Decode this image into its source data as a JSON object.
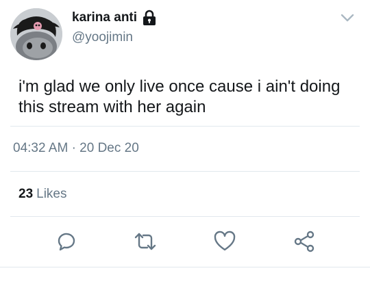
{
  "author": {
    "display_name": "karina anti",
    "handle": "@yoojimin",
    "protected_icon": "lock-icon",
    "avatar_icon": "avatar-kuromi"
  },
  "menu_icon": "chevron-down-icon",
  "tweet": {
    "text": "i'm glad we only live once cause i ain't doing this stream with her again",
    "time": "04:32 AM",
    "separator": "·",
    "date": "20 Dec 20"
  },
  "stats": {
    "likes_count": "23",
    "likes_label": "Likes"
  },
  "actions": [
    {
      "icon": "reply-icon"
    },
    {
      "icon": "retweet-icon"
    },
    {
      "icon": "like-icon"
    },
    {
      "icon": "share-icon"
    }
  ],
  "colors": {
    "text": "#14171a",
    "secondary": "#657786",
    "divider": "#e1e8ed"
  }
}
